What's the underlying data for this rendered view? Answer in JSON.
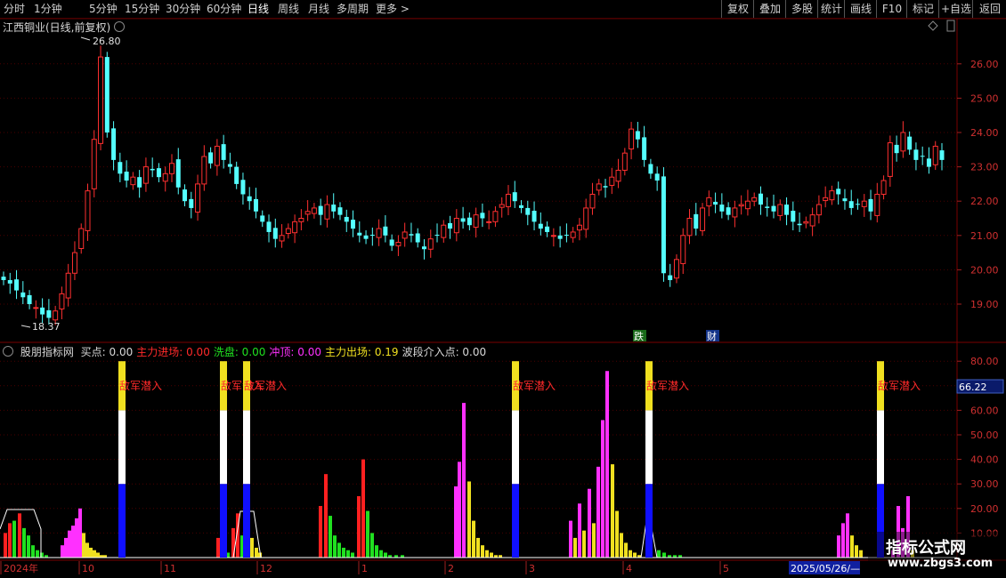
{
  "toolbar": {
    "periods": [
      "分时",
      "1分钟",
      "5分钟",
      "15分钟",
      "30分钟",
      "60分钟",
      "日线",
      "周线",
      "月线",
      "多周期",
      "更多 >"
    ],
    "active_period": "日线",
    "right_buttons": [
      "复权",
      "叠加",
      "多股",
      "统计",
      "画线",
      "F10",
      "+自选",
      "返回"
    ]
  },
  "stock": {
    "title": "江西铜业(日线,前复权)",
    "high_label": "26.80",
    "low_label": "18.37",
    "event_labels": [
      "跌",
      "财"
    ]
  },
  "price_axis": [
    "26.00",
    "25.00",
    "24.00",
    "23.00",
    "22.00",
    "21.00",
    "20.00",
    "19.00"
  ],
  "indicator": {
    "name": "股朋指标网",
    "fields": [
      {
        "label": "买点:",
        "value": "0.00",
        "color": "#d8d8d8"
      },
      {
        "label": "主力进场:",
        "value": "0.00",
        "color": "#ff2a2a"
      },
      {
        "label": "洗盘:",
        "value": "0.00",
        "color": "#20e020"
      },
      {
        "label": "冲顶:",
        "value": "0.00",
        "color": "#ff30ff"
      },
      {
        "label": "主力出场:",
        "value": "0.19",
        "color": "#f0e020"
      },
      {
        "label": "波段介入点:",
        "value": "0.00",
        "color": "#d8d8d8"
      }
    ],
    "axis": [
      "80.00",
      "70.00",
      "60.00",
      "50.00",
      "40.00",
      "30.00",
      "20.00",
      "10.00"
    ],
    "current_value": "66.22",
    "signal_text": "敌军潜入"
  },
  "time_axis": {
    "labels": [
      "2024年",
      "10",
      "11",
      "12",
      "1",
      "2",
      "3",
      "4",
      "5"
    ],
    "cursor_date": "2025/05/26/—"
  },
  "watermark": {
    "main": "指标公式网",
    "url": "www.zbgs3.com"
  },
  "colors": {
    "up": "#ff3030",
    "down": "#54ffff",
    "grid": "#5a0000",
    "axis_text": "#d03030"
  }
}
